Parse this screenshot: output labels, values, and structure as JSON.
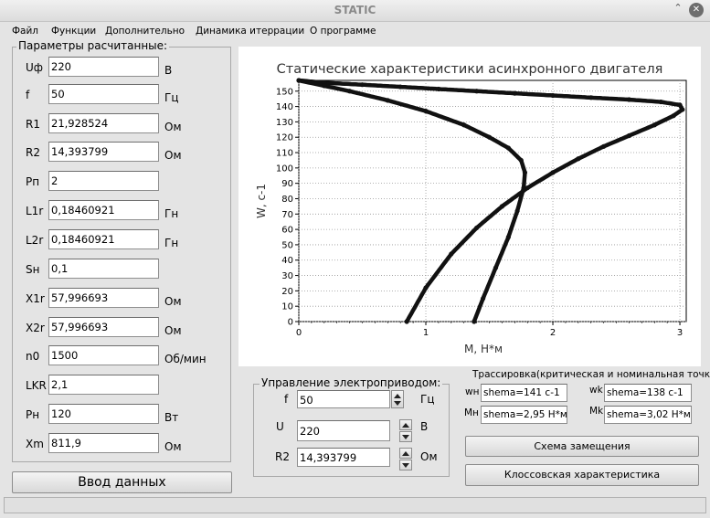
{
  "window": {
    "title": "STATIC"
  },
  "menu": [
    "Файл",
    "Функции",
    "Дополнительно",
    "Динамика итеррации",
    "О программе"
  ],
  "params": {
    "title": "Параметры расчитанные:",
    "rows": [
      {
        "label": "Uф",
        "value": "220",
        "unit": "В"
      },
      {
        "label": "f",
        "value": "50",
        "unit": "Гц"
      },
      {
        "label": "R1",
        "value": "21,928524",
        "unit": "Ом"
      },
      {
        "label": "R2",
        "value": "14,393799",
        "unit": "Ом"
      },
      {
        "label": "Pп",
        "value": "2",
        "unit": ""
      },
      {
        "label": "L1r",
        "value": "0,18460921",
        "unit": "Гн"
      },
      {
        "label": "L2r",
        "value": "0,18460921",
        "unit": "Гн"
      },
      {
        "label": "Sн",
        "value": "0,1",
        "unit": ""
      },
      {
        "label": "X1r",
        "value": "57,996693",
        "unit": "Ом"
      },
      {
        "label": "X2r",
        "value": "57,996693",
        "unit": "Ом"
      },
      {
        "label": "n0",
        "value": "1500",
        "unit": "Об/мин"
      },
      {
        "label": "LKR",
        "value": "2,1",
        "unit": ""
      },
      {
        "label": "Pн",
        "value": "120",
        "unit": "Вт"
      },
      {
        "label": "Xm",
        "value": "811,9",
        "unit": "Ом"
      }
    ],
    "input_button": "Ввод данных"
  },
  "control": {
    "title": "Управление электроприводом:",
    "f": {
      "label": "f",
      "value": "50",
      "unit": "Гц"
    },
    "u": {
      "label": "U",
      "value": "220",
      "unit": "В"
    },
    "r2": {
      "label": "R2",
      "value": "14,393799",
      "unit": "Ом"
    }
  },
  "trace": {
    "title": "Трассировка(критическая и номинальная точки)",
    "wn": {
      "label": "wн",
      "value": "shema=141 с-1"
    },
    "wk": {
      "label": "wk",
      "value": "shema=138 с-1"
    },
    "mn": {
      "label": "Mн",
      "value": "shema=2,95 Н*м"
    },
    "mk": {
      "label": "Mk",
      "value": "shema=3,02 Н*м"
    }
  },
  "buttons": {
    "scheme": "Схема замещения",
    "kloss": "Клоссовская характеристика"
  },
  "chart_data": {
    "type": "scatter",
    "title": "Статические характеристики асинхронного двигателя",
    "xlabel": "М, Н*м",
    "ylabel": "W, c-1",
    "xlim": [
      0,
      3.05
    ],
    "ylim": [
      0,
      157
    ],
    "xticks": [
      "0",
      "1",
      "2",
      "3"
    ],
    "yticks": [
      "0",
      "10",
      "20",
      "30",
      "40",
      "50",
      "60",
      "70",
      "80",
      "90",
      "100",
      "110",
      "120",
      "130",
      "140",
      "150"
    ],
    "grid": true,
    "series": [
      {
        "x": [
          0.85,
          1.0,
          1.2,
          1.4,
          1.6,
          1.8,
          2.0,
          2.2,
          2.4,
          2.6,
          2.8,
          2.95,
          3.02,
          3.0,
          2.85,
          2.6,
          2.3,
          2.0,
          1.7,
          1.4,
          1.1,
          0.8,
          0.5,
          0.2,
          0.0
        ],
        "y": [
          0,
          22,
          44,
          61,
          75,
          87,
          97,
          106,
          114,
          121,
          128,
          134,
          138,
          141,
          143,
          144.5,
          145.8,
          147.2,
          148.6,
          150,
          151.4,
          152.8,
          154.2,
          155.5,
          157
        ]
      },
      {
        "x": [
          1.38,
          1.45,
          1.55,
          1.65,
          1.72,
          1.77,
          1.78,
          1.75,
          1.65,
          1.5,
          1.3,
          1.0,
          0.7,
          0.4,
          0.2,
          0.0
        ],
        "y": [
          0,
          15,
          35,
          55,
          72,
          87,
          97,
          105,
          113,
          120,
          128,
          137,
          144,
          150,
          153.5,
          157
        ]
      }
    ]
  }
}
